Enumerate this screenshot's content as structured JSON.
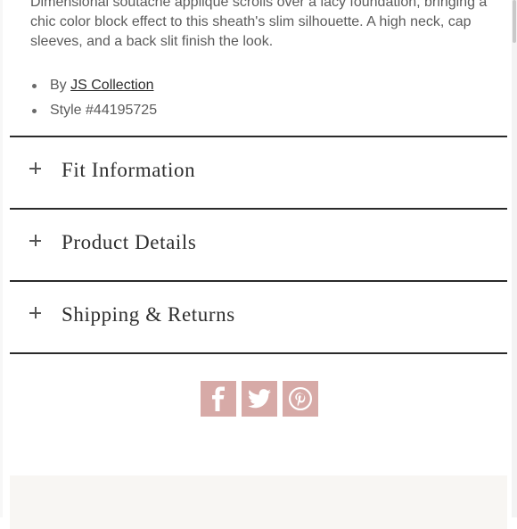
{
  "description": "Dimensional soutache applique scrolls over a lacy foundation, bringing a chic color block effect to this sheath's slim silhouette. A high neck, cap sleeves, and a back slit finish the look.",
  "meta": {
    "by_prefix": "By ",
    "brand": "JS Collection",
    "style": "Style #44195725"
  },
  "accordion": [
    {
      "label": "Fit Information"
    },
    {
      "label": "Product Details"
    },
    {
      "label": "Shipping & Returns"
    }
  ],
  "share": {
    "icons": [
      "facebook-icon",
      "twitter-icon",
      "pinterest-icon"
    ],
    "color": "#d7aaa7"
  },
  "colors": {
    "divider": "#2a2a2a",
    "footer_panel": "#f8f6f3"
  }
}
